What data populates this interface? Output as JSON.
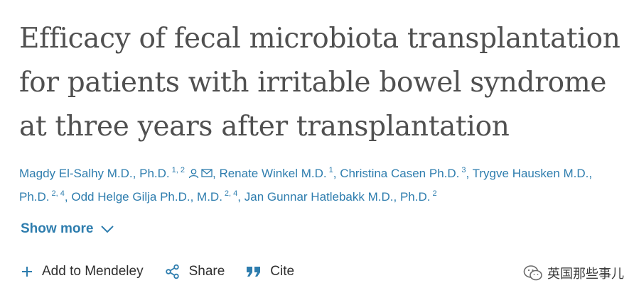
{
  "title": "Efficacy of fecal microbiota transplantation for patients with irritable bowel syndrome at three years after transplantation",
  "authors": [
    {
      "name": "Magdy El-Salhy M.D., Ph.D.",
      "sup": "1, 2",
      "sep": ", ",
      "corresponding": true
    },
    {
      "name": "Renate Winkel M.D.",
      "sup": "1",
      "sep": ", "
    },
    {
      "name": "Christina Casen Ph.D.",
      "sup": "3",
      "sep": ", "
    },
    {
      "name": "Trygve Hausken M.D., Ph.D.",
      "sup": "2, 4",
      "sep": ", "
    },
    {
      "name": "Odd Helge Gilja Ph.D., M.D.",
      "sup": "2, 4",
      "sep": ", "
    },
    {
      "name": "Jan Gunnar Hatlebakk M.D., Ph.D.",
      "sup": "2",
      "sep": ""
    }
  ],
  "show_more": {
    "label": "Show more",
    "icon": "chevron-down-icon"
  },
  "actions": [
    {
      "label": "Add to Mendeley",
      "icon": "plus-icon"
    },
    {
      "label": "Share",
      "icon": "share-icon"
    },
    {
      "label": "Cite",
      "icon": "quote-icon"
    }
  ],
  "watermark": {
    "text": "英国那些事儿",
    "icon": "wechat-icon"
  },
  "colors": {
    "link": "#2e7dae",
    "title": "#505050",
    "text": "#2e2e2e"
  }
}
